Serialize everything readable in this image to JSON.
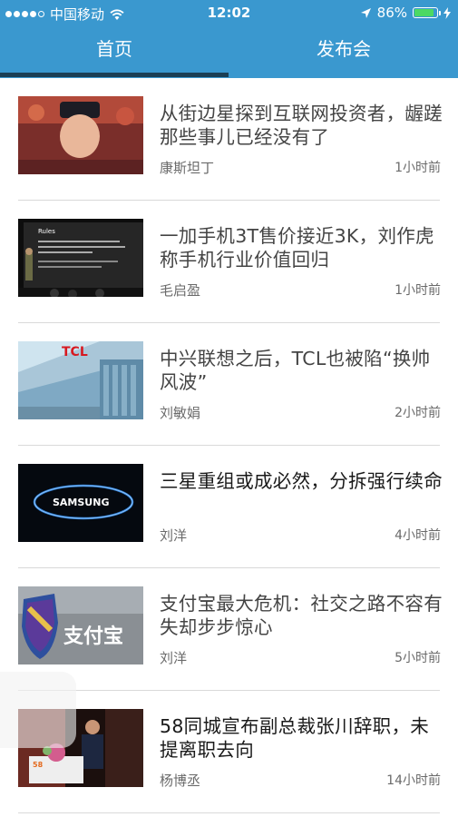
{
  "status_bar": {
    "carrier": "中国移动",
    "time": "12:02",
    "battery": "86%",
    "battery_level": 0.86
  },
  "tabs": [
    {
      "label": "首页",
      "active": true
    },
    {
      "label": "发布会",
      "active": false
    }
  ],
  "colors": {
    "header": "#3a98cf",
    "indicator": "#1b3f55",
    "battery": "#4cd964"
  },
  "articles": [
    {
      "title": "从街边星探到互联网投资者，龌蹉那些事儿已经没有了",
      "author": "康斯坦丁",
      "time": "1小时前"
    },
    {
      "title": "一加手机3T售价接近3K，刘作虎称手机行业价值回归",
      "author": "毛启盈",
      "time": "1小时前"
    },
    {
      "title": "中兴联想之后，TCL也被陷“换帅风波”",
      "author": "刘敏娟",
      "time": "2小时前"
    },
    {
      "title": "三星重组或成必然，分拆强行续命",
      "author": "刘洋",
      "time": "4小时前"
    },
    {
      "title": "支付宝最大危机：社交之路不容有失却步步惊心",
      "author": "刘洋",
      "time": "5小时前"
    },
    {
      "title": "58同城宣布副总裁张川辞职，未提离职去向",
      "author": "杨博丞",
      "time": "14小时前"
    }
  ],
  "thumbnails": {
    "t2_caption": "Rules",
    "t3_logo": "TCL",
    "t4_logo": "SAMSUNG",
    "t5_sign": "支付宝",
    "t6_logo": "58"
  }
}
